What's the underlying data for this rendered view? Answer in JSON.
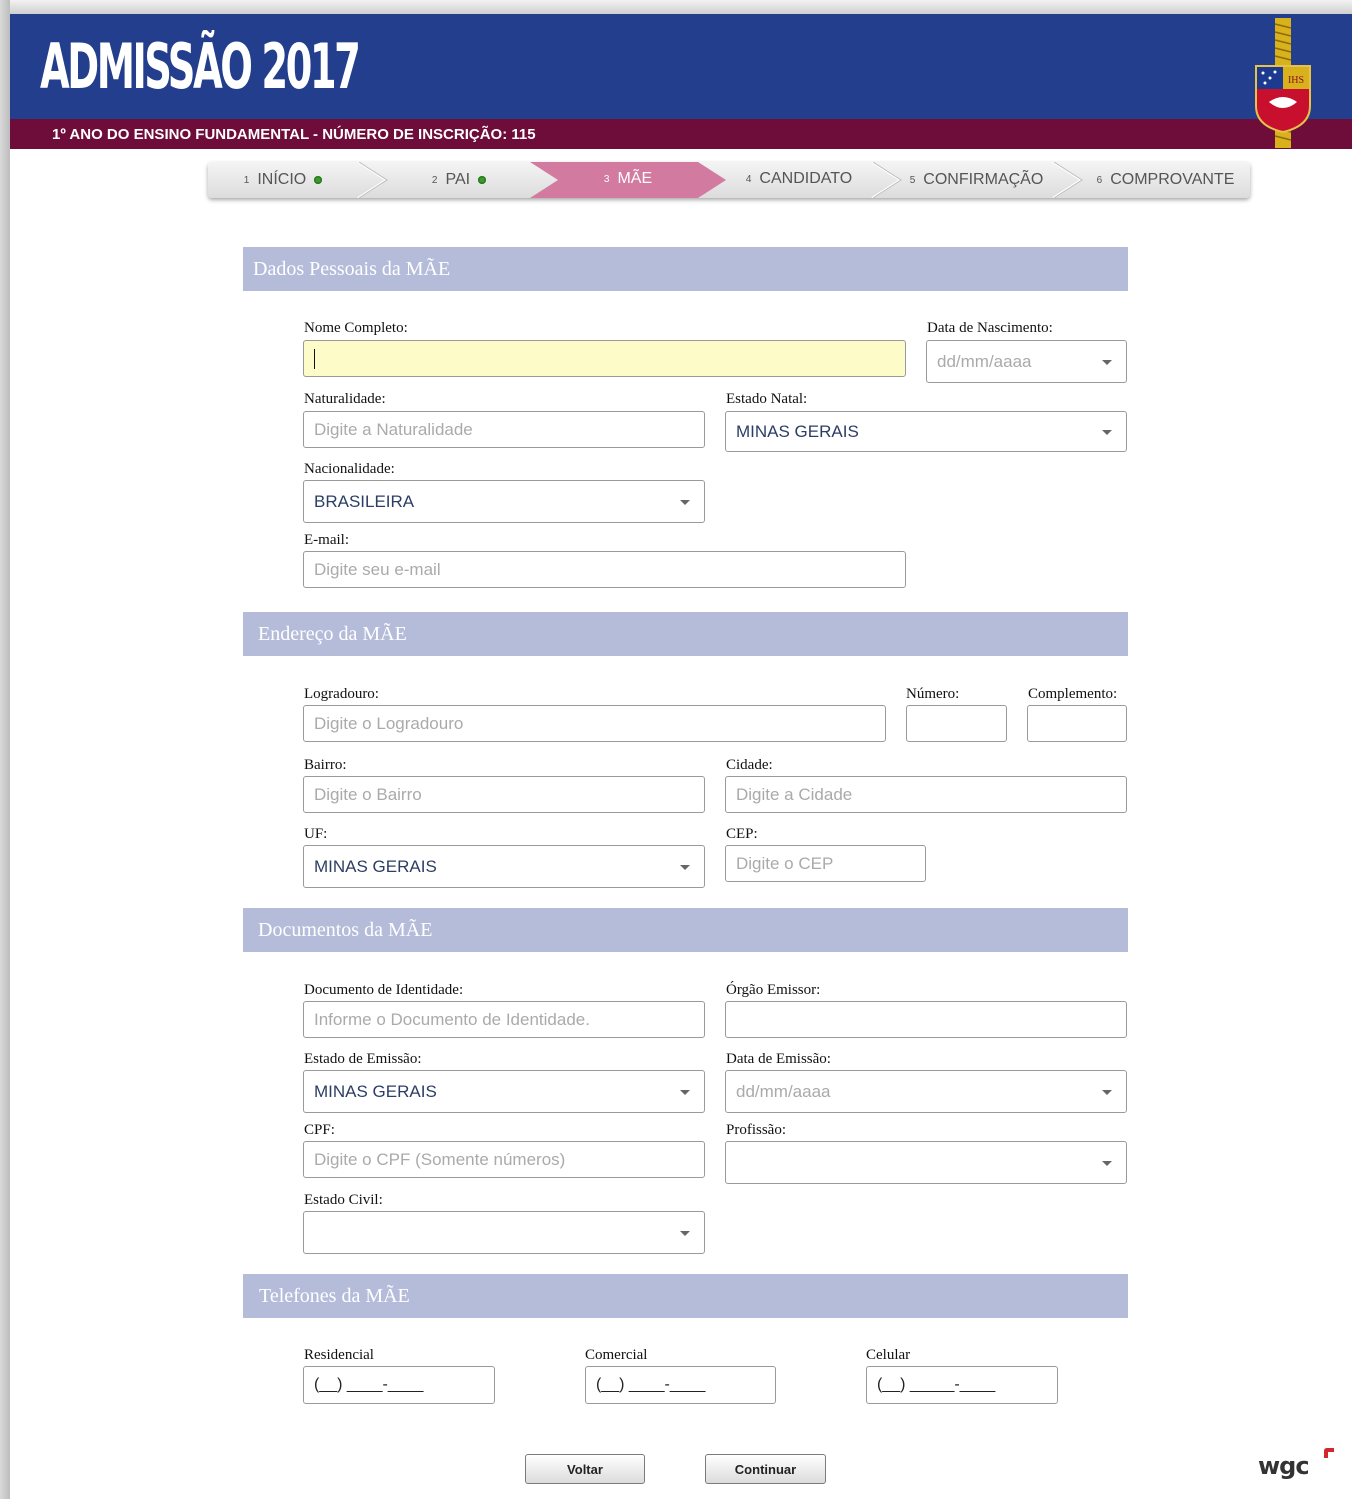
{
  "header": {
    "title": "ADMISSÃO 2017",
    "band_text": "1º ANO DO ENSINO FUNDAMENTAL - NÚMERO DE INSCRIÇÃO: 115",
    "crest_text": "IHS"
  },
  "steps": [
    {
      "num": "1",
      "label": "INÍCIO",
      "done": true
    },
    {
      "num": "2",
      "label": "PAI",
      "done": true
    },
    {
      "num": "3",
      "label": "MÃE",
      "active": true
    },
    {
      "num": "4",
      "label": "CANDIDATO"
    },
    {
      "num": "5",
      "label": "CONFIRMAÇÃO"
    },
    {
      "num": "6",
      "label": "COMPROVANTE"
    }
  ],
  "colors": {
    "header_blue": "#233e8c",
    "header_band": "#6e0d3a",
    "active_step": "#d27aa0",
    "section_head": "#b5bcda",
    "focus_field": "#fdfbc8"
  },
  "personal": {
    "section_title": "Dados Pessoais da MÃE",
    "full_name_label": "Nome Completo:",
    "full_name_value": "",
    "birth_date_label": "Data de Nascimento:",
    "birth_date_placeholder": "dd/mm/aaaa",
    "birthplace_label": "Naturalidade:",
    "birthplace_placeholder": "Digite a Naturalidade",
    "birth_state_label": "Estado Natal:",
    "birth_state_value": "MINAS GERAIS",
    "nationality_label": "Nacionalidade:",
    "nationality_value": "BRASILEIRA",
    "email_label": "E-mail:",
    "email_placeholder": "Digite seu e-mail"
  },
  "address": {
    "section_title": "Endereço da MÃE",
    "street_label": "Logradouro:",
    "street_placeholder": "Digite o Logradouro",
    "number_label": "Número:",
    "complement_label": "Complemento:",
    "district_label": "Bairro:",
    "district_placeholder": "Digite o Bairro",
    "city_label": "Cidade:",
    "city_placeholder": "Digite a Cidade",
    "uf_label": "UF:",
    "uf_value": "MINAS GERAIS",
    "cep_label": "CEP:",
    "cep_placeholder": "Digite o CEP"
  },
  "documents": {
    "section_title": "Documentos da MÃE",
    "id_label": "Documento de Identidade:",
    "id_placeholder": "Informe o Documento de Identidade.",
    "issuer_label": "Órgão Emissor:",
    "issue_state_label": "Estado de Emissão:",
    "issue_state_value": "MINAS GERAIS",
    "issue_date_label": "Data de Emissão:",
    "issue_date_placeholder": "dd/mm/aaaa",
    "cpf_label": "CPF:",
    "cpf_placeholder": "Digite o CPF (Somente números)",
    "profession_label": "Profissão:",
    "marital_label": "Estado Civil:"
  },
  "phones": {
    "section_title": "Telefones da MÃE",
    "residential_label": "Residencial",
    "residential_mask": "(__) ____-____",
    "commercial_label": "Comercial",
    "commercial_mask": "(__) ____-____",
    "mobile_label": "Celular",
    "mobile_mask": "(__) _____-____"
  },
  "buttons": {
    "back": "Voltar",
    "continue": "Continuar"
  },
  "footer": {
    "logo": "wgc"
  }
}
